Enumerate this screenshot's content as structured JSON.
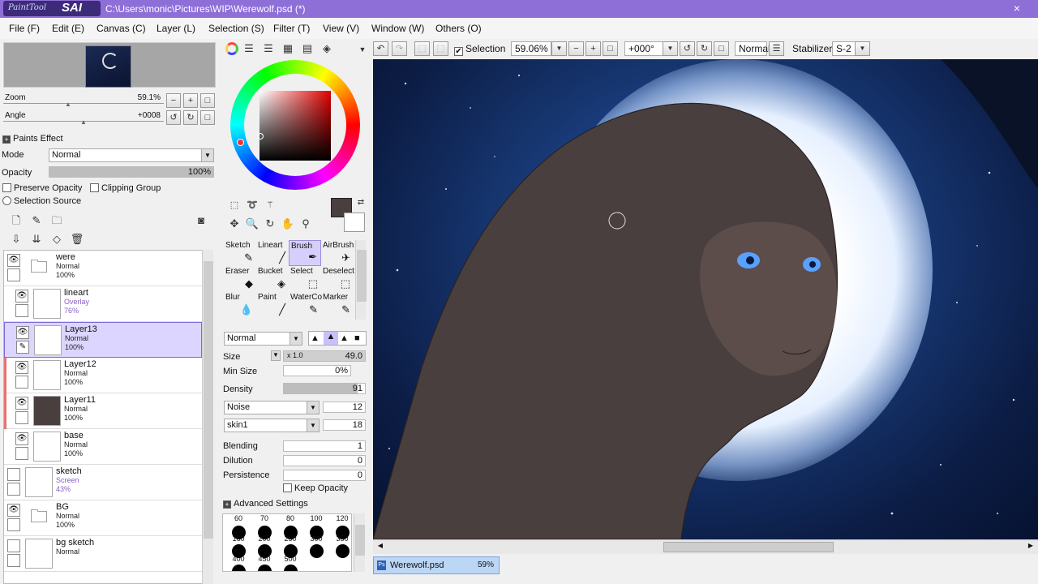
{
  "titlebar": {
    "logo_small": "PaintTool",
    "logo_big": "SAI",
    "title": "C:\\Users\\monic\\Pictures\\WIP\\Werewolf.psd (*)",
    "close": "×"
  },
  "menu": [
    "File (F)",
    "Edit (E)",
    "Canvas (C)",
    "Layer (L)",
    "Selection (S)",
    "Filter (T)",
    "View (V)",
    "Window (W)",
    "Others (O)"
  ],
  "navigator": {
    "zoom_label": "Zoom",
    "zoom_value": "59.1%",
    "angle_label": "Angle",
    "angle_value": "+0008",
    "zoom_fraction": 0.4,
    "angle_fraction": 0.5
  },
  "paints_effect": {
    "header": "Paints Effect",
    "mode_label": "Mode",
    "mode_value": "Normal",
    "opacity_label": "Opacity",
    "opacity_value": "100%",
    "preserve_opacity": "Preserve Opacity",
    "clipping_group": "Clipping Group",
    "selection_source": "Selection Source"
  },
  "layers": [
    {
      "name": "were",
      "mode": "Normal",
      "opacity": "100%",
      "type": "folder",
      "visible": true,
      "selected": false,
      "clip": false,
      "indent": false
    },
    {
      "name": "lineart",
      "mode": "Overlay",
      "opacity": "76%",
      "type": "layer",
      "visible": true,
      "selected": false,
      "clip": false,
      "indent": true
    },
    {
      "name": "Layer13",
      "mode": "Normal",
      "opacity": "100%",
      "type": "layer",
      "visible": true,
      "selected": true,
      "clip": false,
      "indent": true
    },
    {
      "name": "Layer12",
      "mode": "Normal",
      "opacity": "100%",
      "type": "layer",
      "visible": true,
      "selected": false,
      "clip": true,
      "indent": true
    },
    {
      "name": "Layer11",
      "mode": "Normal",
      "opacity": "100%",
      "type": "layer",
      "visible": true,
      "selected": false,
      "clip": true,
      "indent": true
    },
    {
      "name": "base",
      "mode": "Normal",
      "opacity": "100%",
      "type": "layer",
      "visible": true,
      "selected": false,
      "clip": false,
      "indent": true
    },
    {
      "name": "sketch",
      "mode": "Screen",
      "opacity": "43%",
      "type": "layer",
      "visible": false,
      "selected": false,
      "clip": false,
      "indent": false
    },
    {
      "name": "BG",
      "mode": "Normal",
      "opacity": "100%",
      "type": "folder",
      "visible": true,
      "selected": false,
      "clip": false,
      "indent": false
    },
    {
      "name": "bg sketch",
      "mode": "Normal",
      "opacity": "",
      "type": "layer",
      "visible": false,
      "selected": false,
      "clip": false,
      "indent": false
    }
  ],
  "tools": [
    {
      "label": "Sketch",
      "icon": "✎"
    },
    {
      "label": "Lineart",
      "icon": "╱"
    },
    {
      "label": "Brush",
      "icon": "✒"
    },
    {
      "label": "AirBrush",
      "icon": "✈"
    },
    {
      "label": "Eraser",
      "icon": "◆"
    },
    {
      "label": "Bucket",
      "icon": "◈"
    },
    {
      "label": "Select",
      "icon": "⬚"
    },
    {
      "label": "Deselect",
      "icon": "⬚"
    },
    {
      "label": "Blur",
      "icon": "💧"
    },
    {
      "label": "Paint",
      "icon": "╱"
    },
    {
      "label": "WaterCo",
      "icon": "✎"
    },
    {
      "label": "Marker",
      "icon": "✎"
    }
  ],
  "brush": {
    "blend_mode": "Normal",
    "size_label": "Size",
    "size_mult": "x 1.0",
    "size_value": "49.0",
    "min_size_label": "Min Size",
    "min_size_value": "0%",
    "density_label": "Density",
    "density_value": "91",
    "texture": "Noise",
    "texture_value": "12",
    "texture2": "skin1",
    "texture2_value": "18",
    "blending_label": "Blending",
    "blending_value": "1",
    "dilution_label": "Dilution",
    "dilution_value": "0",
    "persistence_label": "Persistence",
    "persistence_value": "0",
    "keep_opacity": "Keep Opacity",
    "advanced": "Advanced Settings",
    "sizes_row1": [
      "60",
      "70",
      "80",
      "100",
      "120"
    ],
    "sizes_row2": [
      "160",
      "200",
      "250",
      "300",
      "350"
    ],
    "sizes_row3": [
      "400",
      "450",
      "500"
    ]
  },
  "toolbar": {
    "selection_label": "Selection",
    "zoom_value": "59.06%",
    "angle_value": "+000°",
    "blend_value": "Normal",
    "stabilizer_label": "Stabilizer",
    "stabilizer_value": "S-2"
  },
  "doctab": {
    "name": "Werewolf.psd",
    "zoom": "59%"
  },
  "colors": {
    "titlebar": "#8e6fd8",
    "selected_layer": "#dcd5ff",
    "primary_color": "#4a3f3f",
    "fur": "#4a3f3f",
    "eye": "#5aa0ff"
  }
}
